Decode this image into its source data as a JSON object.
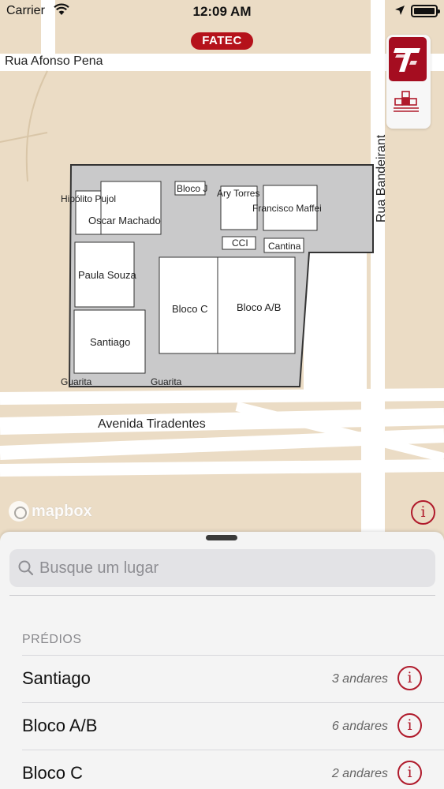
{
  "status_bar": {
    "carrier": "Carrier",
    "time": "12:09 AM"
  },
  "map": {
    "badge": "FATEC",
    "streets": {
      "afonso_pena": "Rua Afonso Pena",
      "tiradentes": "Avenida Tiradentes",
      "bandeirante": "Rua Bandeirant"
    },
    "rooms": {
      "bloco_j": "Bloco J",
      "hipolito_pujol": "Hipólito Pujol",
      "oscar_machado": "Oscar Machado",
      "ary_torres": "Ary Torres",
      "francisco_maffei": "Francisco Maffei",
      "cci": "CCI",
      "cantina": "Cantina",
      "paula_souza": "Paula Souza",
      "bloco_c": "Bloco C",
      "bloco_ab": "Bloco A/B",
      "santiago": "Santiago",
      "guarita_1": "Guarita",
      "guarita_2": "Guarita"
    },
    "attribution": "mapbox",
    "info_glyph": "i"
  },
  "sheet": {
    "search": {
      "placeholder": "Busque um lugar"
    },
    "section_title": "PRÉDIOS",
    "buildings": [
      {
        "name": "Santiago",
        "floors": "3 andares",
        "info_glyph": "i"
      },
      {
        "name": "Bloco A/B",
        "floors": "6 andares",
        "info_glyph": "i"
      },
      {
        "name": "Bloco C",
        "floors": "2 andares",
        "info_glyph": "i"
      }
    ]
  },
  "colors": {
    "map_background": "#ebdcc5",
    "accent_red": "#b5121b",
    "campus_gray": "#c9c9ca"
  }
}
